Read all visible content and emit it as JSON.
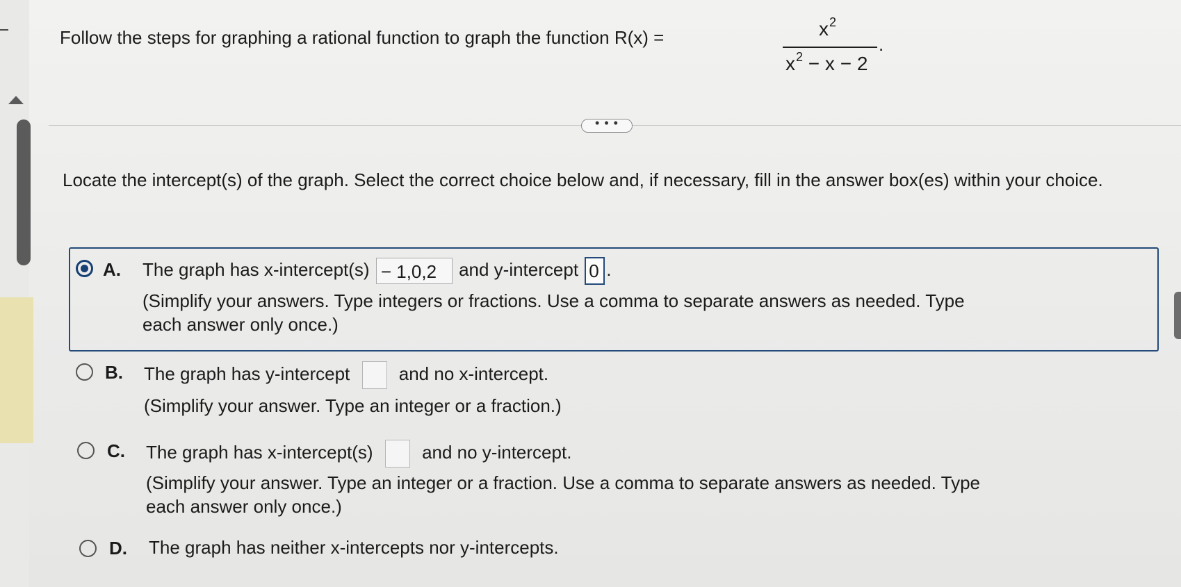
{
  "question": {
    "prefix": "Follow the steps for graphing a rational function to graph the function R(x) =",
    "numerator_base": "x",
    "numerator_power": "2",
    "denominator_base": "x",
    "denominator_power": "2",
    "denominator_tail": " − x − 2",
    "period": "."
  },
  "more_button": "• • •",
  "instruction": "Locate the intercept(s) of the graph. Select the correct choice below and, if necessary, fill in the answer box(es) within your choice.",
  "choices": {
    "a": {
      "letter": "A.",
      "before": "The graph has x-intercept(s)",
      "x_value": "− 1,0,2",
      "middle": "and y-intercept",
      "y_value": "0",
      "after": ".",
      "note_line1": "(Simplify your answers. Type integers or fractions. Use a comma to separate answers as needed. Type",
      "note_line2": "each answer only once.)"
    },
    "b": {
      "letter": "B.",
      "before": "The graph has y-intercept",
      "after": "and no x-intercept.",
      "note": "(Simplify your answer. Type an integer or a fraction.)"
    },
    "c": {
      "letter": "C.",
      "before": "The graph has x-intercept(s)",
      "after": "and no y-intercept.",
      "note_line1": "(Simplify your answer. Type an integer or a fraction. Use a comma to separate answers as needed. Type",
      "note_line2": "each answer only once.)"
    },
    "d": {
      "letter": "D.",
      "text": "The graph has neither x-intercepts nor y-intercepts."
    }
  }
}
